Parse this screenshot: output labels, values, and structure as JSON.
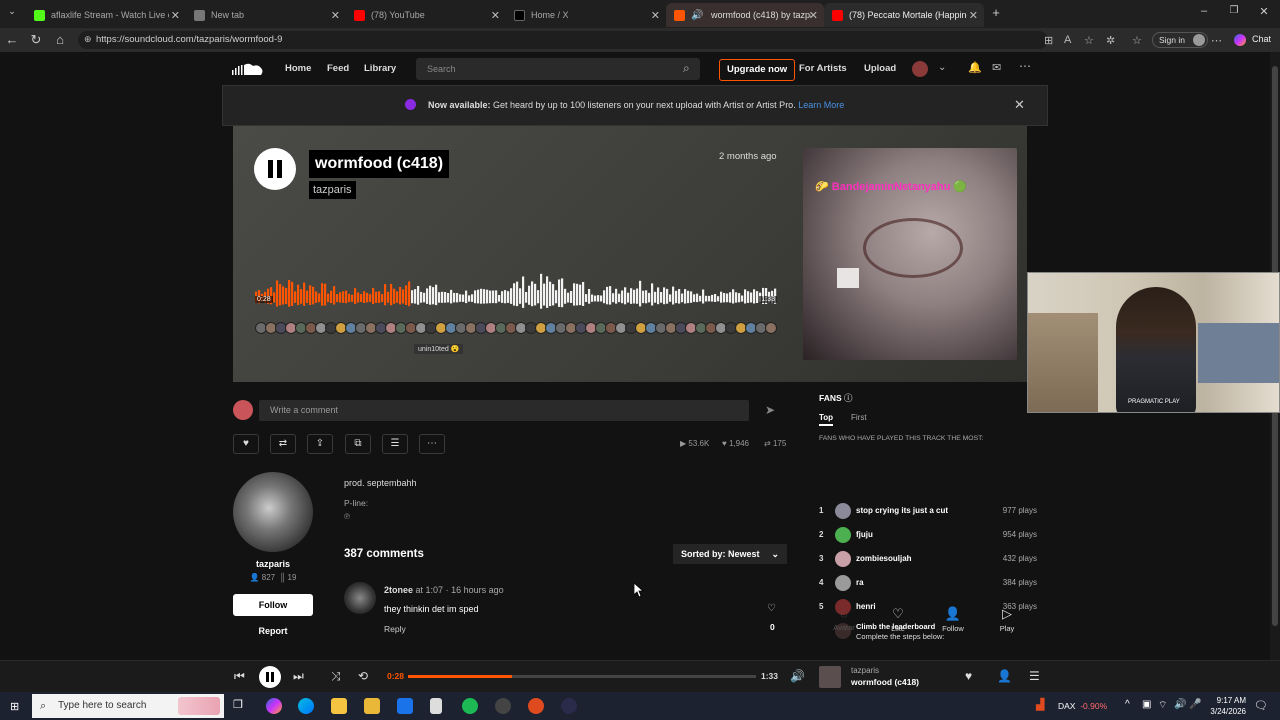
{
  "browser": {
    "tabs": [
      {
        "label": "aflaxlife Stream - Watch Live on K",
        "fav_color": "#53fc18"
      },
      {
        "label": "New tab",
        "fav_color": "#777777"
      },
      {
        "label": "(78) YouTube",
        "fav_color": "#ff0000"
      },
      {
        "label": "Home / X",
        "fav_color": "#000000"
      },
      {
        "label": "wormfood (c418) by tazparis",
        "fav_color": "#ff5500"
      },
      {
        "label": "(78) Peccato Mortale (Happiness #",
        "fav_color": "#ff0000"
      }
    ],
    "url": "https://soundcloud.com/tazparis/wormfood-9",
    "sign_in": "Sign in",
    "chat": "Chat"
  },
  "header": {
    "nav": [
      "Home",
      "Feed",
      "Library"
    ],
    "search_placeholder": "Search",
    "upgrade": "Upgrade now",
    "for_artists": "For Artists",
    "upload": "Upload"
  },
  "banner": {
    "strong": "Now available:",
    "text": " Get heard by up to 100 listeners on your next upload with Artist or Artist Pro. ",
    "link": "Learn More"
  },
  "track": {
    "title": "wormfood (c418)",
    "artist": "tazparis",
    "posted": "2 months ago",
    "artwork_user": "🌮 BandejaminNetanyahu 🟢",
    "time_current": "0:28",
    "time_total": "1:33",
    "progress": 0.3,
    "hover_user": "unin10ted"
  },
  "comment_input_placeholder": "Write a comment",
  "stats": {
    "plays": "53.6K",
    "likes": "1,946",
    "reposts": "175"
  },
  "artist_card": {
    "name": "tazparis",
    "followers": "827",
    "tracks": "19",
    "follow": "Follow",
    "report": "Report"
  },
  "description": {
    "text": "prod. septembahh",
    "pline_label": "P-line:",
    "pline_symbol": "℗"
  },
  "comments": {
    "count": "387 comments",
    "sort": "Sorted by: Newest",
    "items": [
      {
        "user": "2tonee",
        "at": "at 1:07",
        "ago": "· 16 hours ago",
        "body": "they thinkin det im sped",
        "reply": "Reply",
        "likes": "0"
      }
    ]
  },
  "fans": {
    "title": "FANS",
    "tabs": [
      "Top",
      "First"
    ],
    "subtitle": "FANS WHO HAVE PLAYED THIS TRACK THE MOST:",
    "rows": [
      {
        "rank": "1",
        "name": "stop crying its just a cut",
        "plays": "977 plays",
        "color": "#8a8a9a"
      },
      {
        "rank": "2",
        "name": "fjuju",
        "plays": "954 plays",
        "color": "#4caf50"
      },
      {
        "rank": "3",
        "name": "zombiesouljah",
        "plays": "432 plays",
        "color": "#c8a0a8"
      },
      {
        "rank": "4",
        "name": "ra",
        "plays": "384 plays",
        "color": "#9a9a9a"
      },
      {
        "rank": "5",
        "name": "henri",
        "plays": "363 plays",
        "color": "#7a2a2a"
      }
    ],
    "climb_title": "Climb the leaderboard",
    "climb_text": "Complete the steps below:",
    "steps": [
      "Avatar",
      "Like",
      "Follow",
      "Play"
    ]
  },
  "webcam_text": "PRAGMATIC PLAY",
  "player": {
    "artist": "tazparis",
    "title": "wormfood (c418)",
    "time_current": "0:28",
    "time_total": "1:33",
    "progress": 0.3
  },
  "taskbar": {
    "search_placeholder": "Type here to search",
    "ticker": "DAX",
    "ticker_change": "-0.90%",
    "time": "9:17 AM",
    "date": "3/24/2026"
  },
  "colors": {
    "accent": "#ff5500",
    "background": "#121212"
  }
}
